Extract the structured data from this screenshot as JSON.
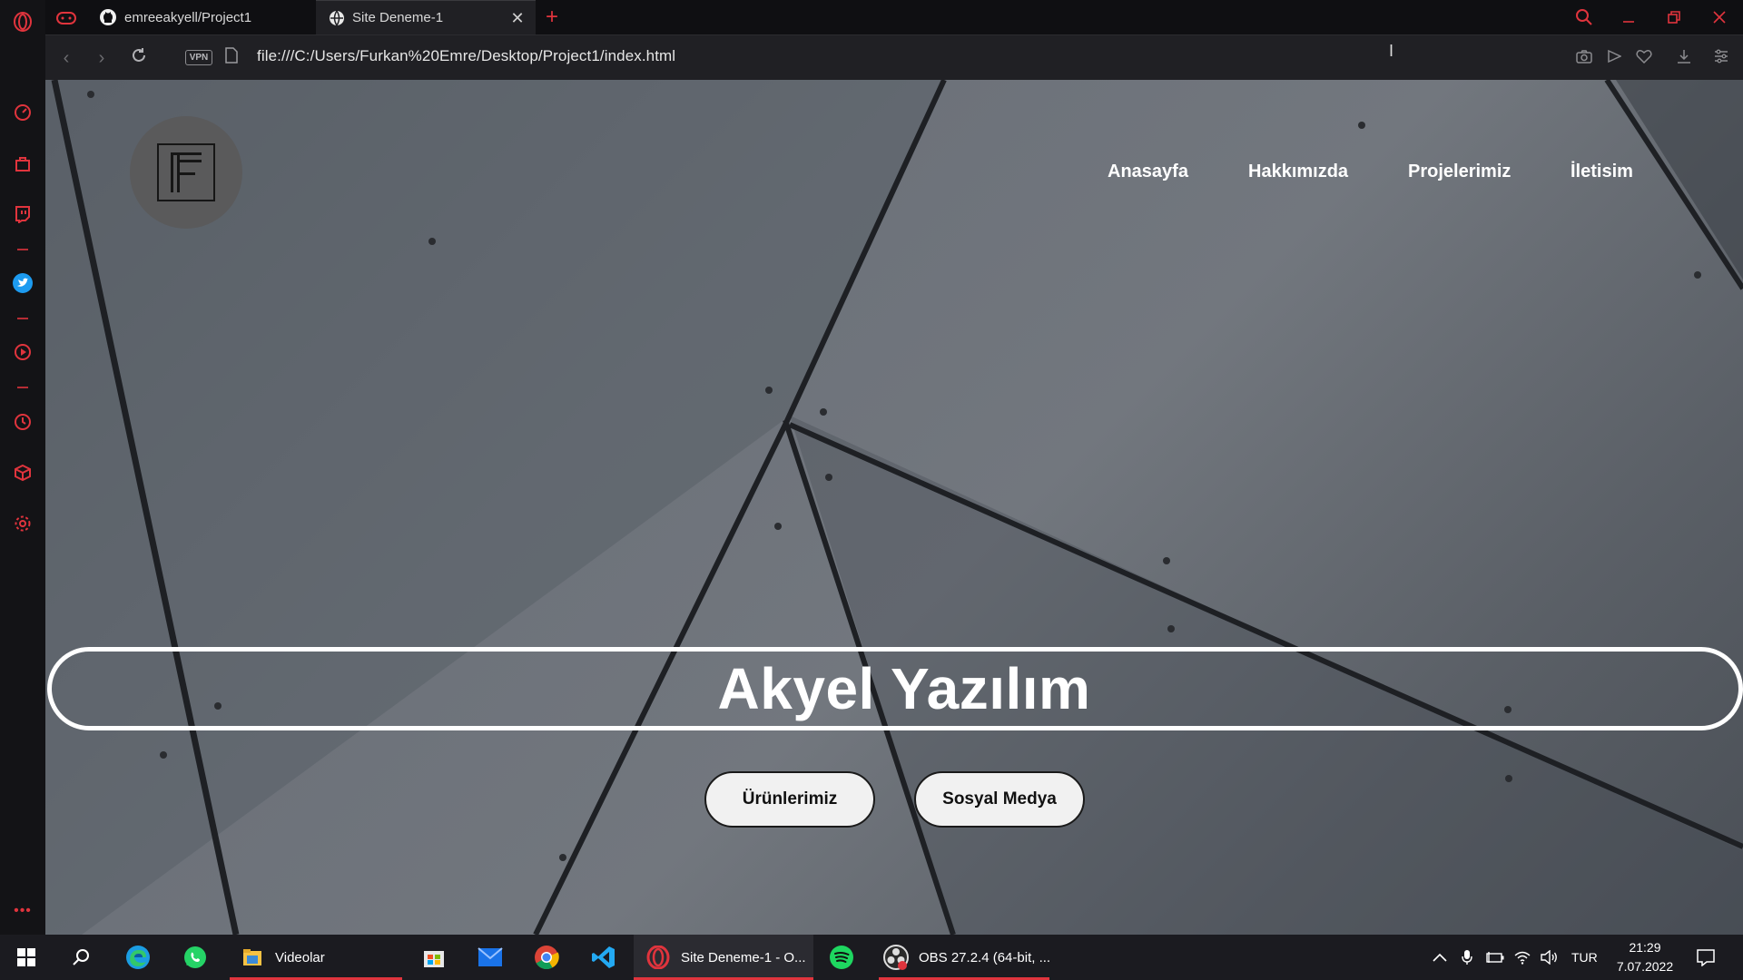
{
  "browser": {
    "tabs": [
      {
        "title": "emreeakyell/Project1",
        "icon": "github-icon",
        "active": false
      },
      {
        "title": "Site Deneme-1",
        "icon": "globe-icon",
        "active": true
      }
    ],
    "address": {
      "vpn_label": "VPN",
      "url": "file:///C:/Users/Furkan%20Emre/Desktop/Project1/index.html"
    }
  },
  "page": {
    "nav": [
      "Anasayfa",
      "Hakkımızda",
      "Projelerimiz",
      "İletisim"
    ],
    "hero_title": "Akyel Yazılım",
    "buttons": {
      "products": "Ürünlerimiz",
      "social": "Sosyal Medya"
    }
  },
  "taskbar": {
    "apps": [
      {
        "name": "windows-start",
        "label": ""
      },
      {
        "name": "search",
        "label": ""
      },
      {
        "name": "edge",
        "label": ""
      },
      {
        "name": "whatsapp",
        "label": ""
      },
      {
        "name": "file-explorer",
        "label": "Videolar"
      },
      {
        "name": "microsoft-store",
        "label": ""
      },
      {
        "name": "mail",
        "label": ""
      },
      {
        "name": "chrome",
        "label": ""
      },
      {
        "name": "vscode",
        "label": ""
      },
      {
        "name": "opera",
        "label": "Site Deneme-1 - O..."
      },
      {
        "name": "spotify",
        "label": ""
      },
      {
        "name": "obs",
        "label": "OBS 27.2.4 (64-bit, ..."
      }
    ],
    "tray": {
      "language": "TUR",
      "time": "21:29",
      "date": "7.07.2022"
    }
  },
  "colors": {
    "accent": "#e0343d",
    "hero_border": "#ffffff",
    "button_bg": "#f1f1f1"
  }
}
